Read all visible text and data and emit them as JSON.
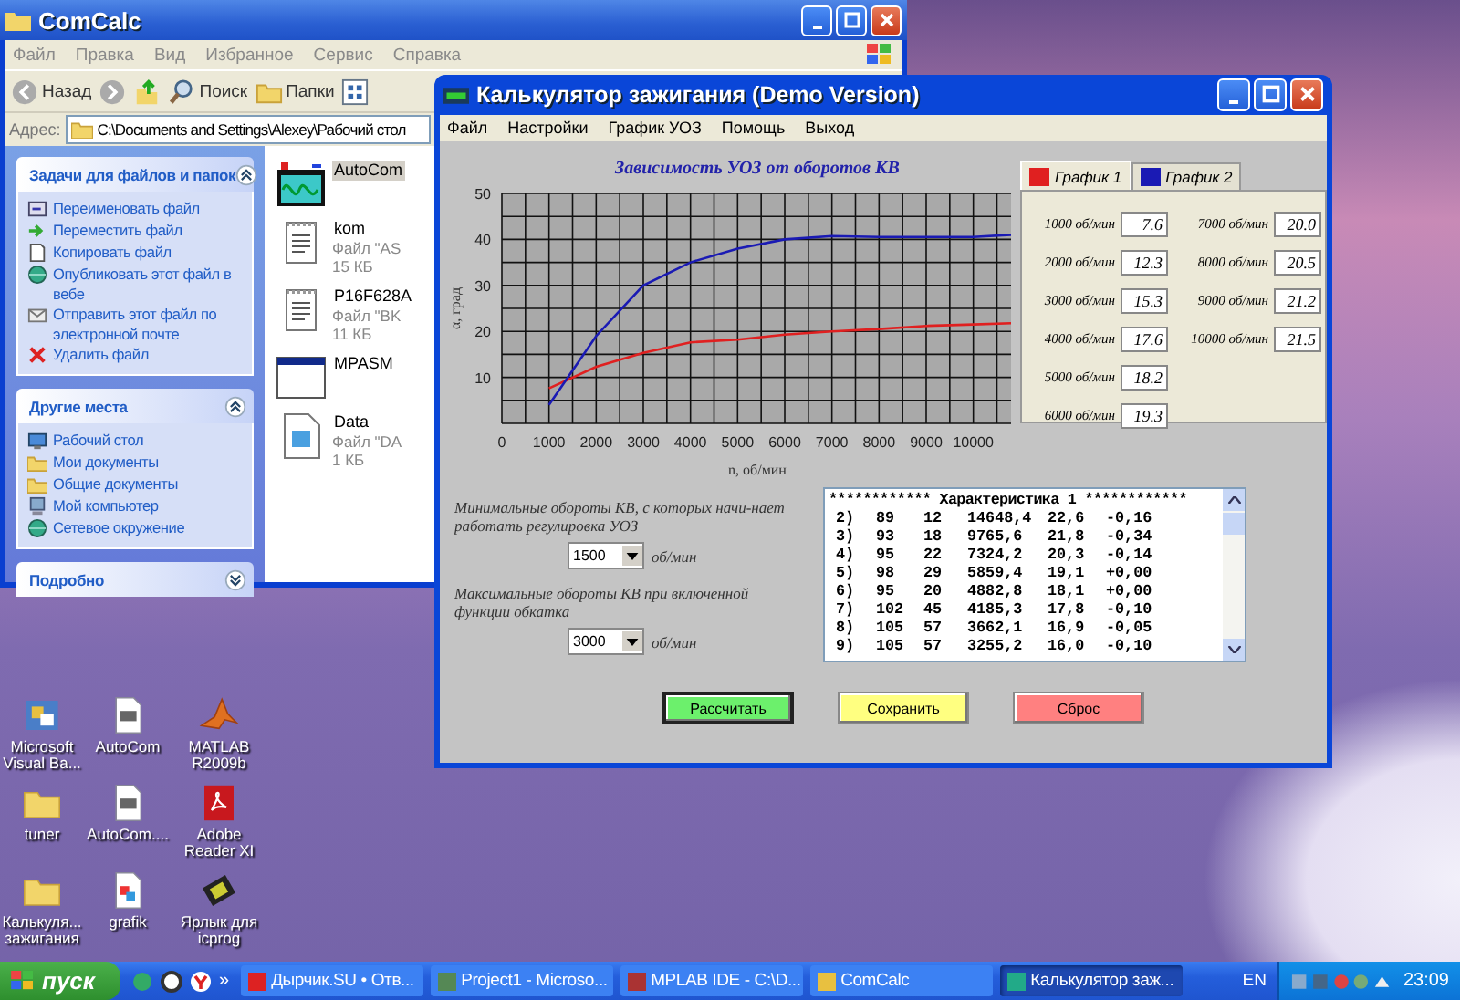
{
  "explorer": {
    "title": "ComCalc",
    "menu": [
      "Файл",
      "Правка",
      "Вид",
      "Избранное",
      "Сервис",
      "Справка"
    ],
    "toolbar": {
      "back": "Назад",
      "search": "Поиск",
      "folders": "Папки"
    },
    "address": {
      "label": "Адрес:",
      "value": "C:\\Documents and Settings\\Alexey\\Рабочий стол"
    },
    "panels": [
      {
        "title": "Задачи для файлов и папок",
        "expanded": true,
        "items": [
          {
            "label": "Переименовать файл",
            "kind": "rename"
          },
          {
            "label": "Переместить файл",
            "kind": "move"
          },
          {
            "label": "Копировать файл",
            "kind": "copy"
          },
          {
            "label": "Опубликовать этот файл в вебе",
            "kind": "web"
          },
          {
            "label": "Отправить этот файл по электронной почте",
            "kind": "mail"
          },
          {
            "label": "Удалить файл",
            "kind": "delete"
          }
        ]
      },
      {
        "title": "Другие места",
        "expanded": true,
        "items": [
          {
            "label": "Рабочий стол",
            "kind": "desktop"
          },
          {
            "label": "Мои документы",
            "kind": "folder"
          },
          {
            "label": "Общие документы",
            "kind": "folder"
          },
          {
            "label": "Мой компьютер",
            "kind": "computer"
          },
          {
            "label": "Сетевое окружение",
            "kind": "network"
          }
        ]
      },
      {
        "title": "Подробно",
        "expanded": false
      }
    ],
    "files": [
      {
        "name": "AutoCom",
        "kind": "app",
        "selected": true
      },
      {
        "name": "kom",
        "type": "Файл \"AS",
        "size": "15 КБ",
        "kind": "text",
        "selected": false
      },
      {
        "name": "P16F628A",
        "type": "Файл \"BK",
        "size": "11 КБ",
        "kind": "text",
        "selected": false
      },
      {
        "name": "MPASM",
        "kind": "window",
        "selected": false
      },
      {
        "name": "Data",
        "type": "Файл \"DA",
        "size": "1 КБ",
        "kind": "data",
        "selected": false
      }
    ]
  },
  "calculator": {
    "title": "Калькулятор зажигания (Demo Version)",
    "menu": [
      "Файл",
      "Настройки",
      "График УОЗ",
      "Помощь",
      "Выход"
    ],
    "chart_data": {
      "type": "line",
      "title": "Зависимость УОЗ от оборотов КВ",
      "xlabel": "n, об/мин",
      "ylabel": "α, град",
      "x": [
        1000,
        2000,
        3000,
        4000,
        5000,
        6000,
        7000,
        8000,
        9000,
        10000,
        10800
      ],
      "series": [
        {
          "name": "График 1",
          "color": "#e02020",
          "values": [
            7.6,
            12.3,
            15.3,
            17.6,
            18.2,
            19.3,
            20.0,
            20.5,
            21.2,
            21.5,
            21.8
          ]
        },
        {
          "name": "График 2",
          "color": "#1a1ab4",
          "values": [
            4,
            19,
            30,
            35,
            38,
            40,
            40.7,
            40.5,
            40.5,
            40.5,
            41
          ]
        }
      ],
      "xlim": [
        0,
        10800
      ],
      "ylim": [
        0,
        50
      ],
      "grid": true,
      "xticks": [
        0,
        1000,
        2000,
        3000,
        4000,
        5000,
        6000,
        7000,
        8000,
        9000,
        10000
      ],
      "yticks": [
        10,
        20,
        30,
        40,
        50
      ]
    },
    "tabs": [
      {
        "selected": true
      },
      {
        "selected": false
      }
    ],
    "points": [
      {
        "label": "1000 об/мин",
        "value": "7.6"
      },
      {
        "label": "2000 об/мин",
        "value": "12.3"
      },
      {
        "label": "3000 об/мин",
        "value": "15.3"
      },
      {
        "label": "4000 об/мин",
        "value": "17.6"
      },
      {
        "label": "5000 об/мин",
        "value": "18.2"
      },
      {
        "label": "6000 об/мин",
        "value": "19.3"
      },
      {
        "label": "7000 об/мин",
        "value": "20.0"
      },
      {
        "label": "8000 об/мин",
        "value": "20.5"
      },
      {
        "label": "9000 об/мин",
        "value": "21.2"
      },
      {
        "label": "10000 об/мин",
        "value": "21.5"
      }
    ],
    "settings": [
      {
        "label": "Минимальные обороты КВ, с которых начи-нает работать регулировка УОЗ",
        "value": "1500",
        "unit": "об/мин"
      },
      {
        "label": "Максимальные обороты КВ при включенной функции обкатка",
        "value": "3000",
        "unit": "об/мин"
      }
    ],
    "listing": {
      "header": "************ Характеристика 1 ************",
      "rows": [
        [
          "2)",
          "89",
          "12",
          "14648,4",
          "22,6",
          "-0,16"
        ],
        [
          "3)",
          "93",
          "18",
          "9765,6",
          "21,8",
          "-0,34"
        ],
        [
          "4)",
          "95",
          "22",
          "7324,2",
          "20,3",
          "-0,14"
        ],
        [
          "5)",
          "98",
          "29",
          "5859,4",
          "19,1",
          "+0,00"
        ],
        [
          "6)",
          "95",
          "20",
          "4882,8",
          "18,1",
          "+0,00"
        ],
        [
          "7)",
          "102",
          "45",
          "4185,3",
          "17,8",
          "-0,10"
        ],
        [
          "8)",
          "105",
          "57",
          "3662,1",
          "16,9",
          "-0,05"
        ],
        [
          "9)",
          "105",
          "57",
          "3255,2",
          "16,0",
          "-0,10"
        ]
      ]
    },
    "buttons": [
      {
        "label": "Рассчитать",
        "color": "#6cf06c",
        "focused": true
      },
      {
        "label": "Сохранить",
        "color": "#ffff80",
        "focused": false
      },
      {
        "label": "Сброс",
        "color": "#ff8080",
        "focused": false
      }
    ]
  },
  "desktop_icons": [
    {
      "label": "Microsoft Visual Ba...",
      "kind": "app"
    },
    {
      "label": "AutoCom",
      "kind": "file"
    },
    {
      "label": "MATLAB R2009b",
      "kind": "matlab"
    },
    {
      "label": "tuner",
      "kind": "folder"
    },
    {
      "label": "AutoCom....",
      "kind": "file"
    },
    {
      "label": "Adobe Reader XI",
      "kind": "pdf"
    },
    {
      "label": "Калькуля... зажигания",
      "kind": "folder"
    },
    {
      "label": "grafik",
      "kind": "image"
    },
    {
      "label": "Ярлык для icprog",
      "kind": "chip"
    }
  ],
  "taskbar": {
    "start": "пуск",
    "more": "»",
    "tasks": [
      {
        "label": "Дырчик.SU • Отв...",
        "selected": false
      },
      {
        "label": "Project1 - Microso...",
        "selected": false
      },
      {
        "label": "MPLAB IDE - C:\\D...",
        "selected": false
      },
      {
        "label": "ComCalc",
        "selected": false
      },
      {
        "label": "Калькулятор заж...",
        "selected": true
      }
    ],
    "language": "EN",
    "clock": "23:09"
  }
}
